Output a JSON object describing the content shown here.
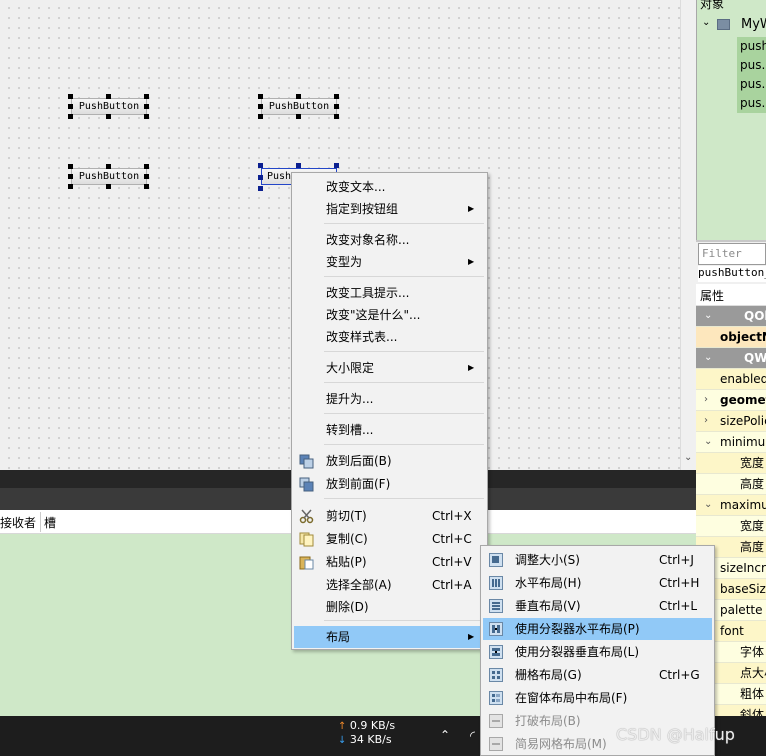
{
  "canvas": {
    "buttons": [
      "PushButton",
      "PushButton",
      "PushButton",
      "Push"
    ]
  },
  "signal_editor": {
    "columns": [
      "接收者",
      "槽"
    ]
  },
  "taskbar": {
    "upload_arrow": "↑",
    "upload": "0.9 KB/s",
    "download_arrow": "↓",
    "download": "34 KB/s"
  },
  "object_inspector": {
    "title": "对象",
    "root": "MyW",
    "children": [
      "push",
      "pus..",
      "pus..",
      "pus.."
    ]
  },
  "property_editor": {
    "filter_placeholder": "Filter",
    "object_name": "pushButton_",
    "header": "属性",
    "rows": [
      {
        "label": "QObjec",
        "kind": "group"
      },
      {
        "label": "objectN",
        "kind": "obj"
      },
      {
        "label": "QWidge",
        "kind": "group"
      },
      {
        "label": "enabled",
        "kind": "plain"
      },
      {
        "label": "geomet",
        "kind": "bold"
      },
      {
        "label": "sizePolic",
        "kind": "plain"
      },
      {
        "label": "minimum",
        "kind": "plain"
      },
      {
        "label": "宽度",
        "kind": "sub"
      },
      {
        "label": "高度",
        "kind": "sub"
      },
      {
        "label": "maximu",
        "kind": "plain"
      },
      {
        "label": "宽度",
        "kind": "sub"
      },
      {
        "label": "高度",
        "kind": "sub"
      },
      {
        "label": "sizeIncre",
        "kind": "plain"
      },
      {
        "label": "baseSize",
        "kind": "plain"
      },
      {
        "label": "palette",
        "kind": "plain"
      },
      {
        "label": "font",
        "kind": "plain"
      },
      {
        "label": "字体",
        "kind": "sub"
      },
      {
        "label": "点大小",
        "kind": "sub"
      },
      {
        "label": "粗体",
        "kind": "sub"
      },
      {
        "label": "斜体",
        "kind": "sub"
      }
    ]
  },
  "context_menu": {
    "items": [
      {
        "label": "改变文本...",
        "shortcut": "",
        "submenu": false
      },
      {
        "label": "指定到按钮组",
        "shortcut": "",
        "submenu": true
      },
      {
        "label": "改变对象名称...",
        "shortcut": "",
        "submenu": false
      },
      {
        "label": "变型为",
        "shortcut": "",
        "submenu": true
      },
      {
        "label": "改变工具提示...",
        "shortcut": "",
        "submenu": false
      },
      {
        "label": "改变\"这是什么\"...",
        "shortcut": "",
        "submenu": false
      },
      {
        "label": "改变样式表...",
        "shortcut": "",
        "submenu": false
      },
      {
        "label": "大小限定",
        "shortcut": "",
        "submenu": true
      },
      {
        "label": "提升为...",
        "shortcut": "",
        "submenu": false
      },
      {
        "label": "转到槽...",
        "shortcut": "",
        "submenu": false
      },
      {
        "label": "放到后面(B)",
        "shortcut": "",
        "submenu": false
      },
      {
        "label": "放到前面(F)",
        "shortcut": "",
        "submenu": false
      },
      {
        "label": "剪切(T)",
        "shortcut": "Ctrl+X",
        "submenu": false
      },
      {
        "label": "复制(C)",
        "shortcut": "Ctrl+C",
        "submenu": false
      },
      {
        "label": "粘贴(P)",
        "shortcut": "Ctrl+V",
        "submenu": false
      },
      {
        "label": "选择全部(A)",
        "shortcut": "Ctrl+A",
        "submenu": false
      },
      {
        "label": "删除(D)",
        "shortcut": "",
        "submenu": false
      },
      {
        "label": "布局",
        "shortcut": "",
        "submenu": true
      }
    ]
  },
  "layout_submenu": {
    "items": [
      {
        "label": "调整大小(S)",
        "shortcut": "Ctrl+J",
        "enabled": true
      },
      {
        "label": "水平布局(H)",
        "shortcut": "Ctrl+H",
        "enabled": true
      },
      {
        "label": "垂直布局(V)",
        "shortcut": "Ctrl+L",
        "enabled": true
      },
      {
        "label": "使用分裂器水平布局(P)",
        "shortcut": "",
        "enabled": true
      },
      {
        "label": "使用分裂器垂直布局(L)",
        "shortcut": "",
        "enabled": true
      },
      {
        "label": "栅格布局(G)",
        "shortcut": "Ctrl+G",
        "enabled": true
      },
      {
        "label": "在窗体布局中布局(F)",
        "shortcut": "",
        "enabled": true
      },
      {
        "label": "打破布局(B)",
        "shortcut": "",
        "enabled": false
      },
      {
        "label": "简易网格布局(M)",
        "shortcut": "",
        "enabled": false
      }
    ]
  },
  "watermark": "CSDN @Halfup",
  "colors": {
    "menu_highlight": "#91c9f7",
    "object_panel": "#cfe8c8",
    "property_group": "#9a9a9a",
    "selection_handle": "#0b1f8f"
  }
}
